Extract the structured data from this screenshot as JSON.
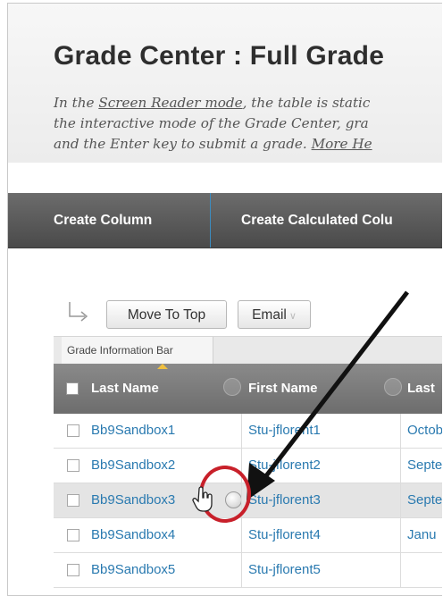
{
  "page": {
    "title": "Grade Center : Full Grade",
    "instructions": {
      "line1_prefix": "In the ",
      "line1_link": "Screen Reader mode",
      "line1_suffix": ", the table is static",
      "line2": "the interactive mode of the Grade Center, gra",
      "line3_prefix": "and the Enter key to submit a grade. ",
      "line3_link": "More He"
    }
  },
  "action_bar": {
    "create_column": "Create Column",
    "create_calculated_column": "Create Calculated Colu"
  },
  "toolbar": {
    "move_to_top": "Move To Top",
    "email": "Email"
  },
  "grade_information_bar": {
    "label": "Grade Information Bar"
  },
  "grid": {
    "columns": [
      "Last Name",
      "First Name",
      "Last"
    ],
    "rows": [
      {
        "last_name": "Bb9Sandbox1",
        "first_name": "Stu-jflorent1",
        "last_access": "Octob"
      },
      {
        "last_name": "Bb9Sandbox2",
        "first_name": "Stu-jflorent2",
        "last_access": "Septe"
      },
      {
        "last_name": "Bb9Sandbox3",
        "first_name": "Stu-jflorent3",
        "last_access": "Septe"
      },
      {
        "last_name": "Bb9Sandbox4",
        "first_name": "Stu-jflorent4",
        "last_access": "Janu"
      },
      {
        "last_name": "Bb9Sandbox5",
        "first_name": "Stu-jflorent5",
        "last_access": ""
      }
    ],
    "highlighted_row_index": 2
  },
  "colors": {
    "action_bar": "#555555",
    "link": "#2a7ab0",
    "annotation_circle": "#c8202a",
    "annotation_arrow": "#111111",
    "info_caret": "#f0c040"
  },
  "icons": {
    "selection_arrow": "arrow-turn-right-icon",
    "column_menu": "circle-menu-icon",
    "cursor": "hand-pointer-icon"
  }
}
